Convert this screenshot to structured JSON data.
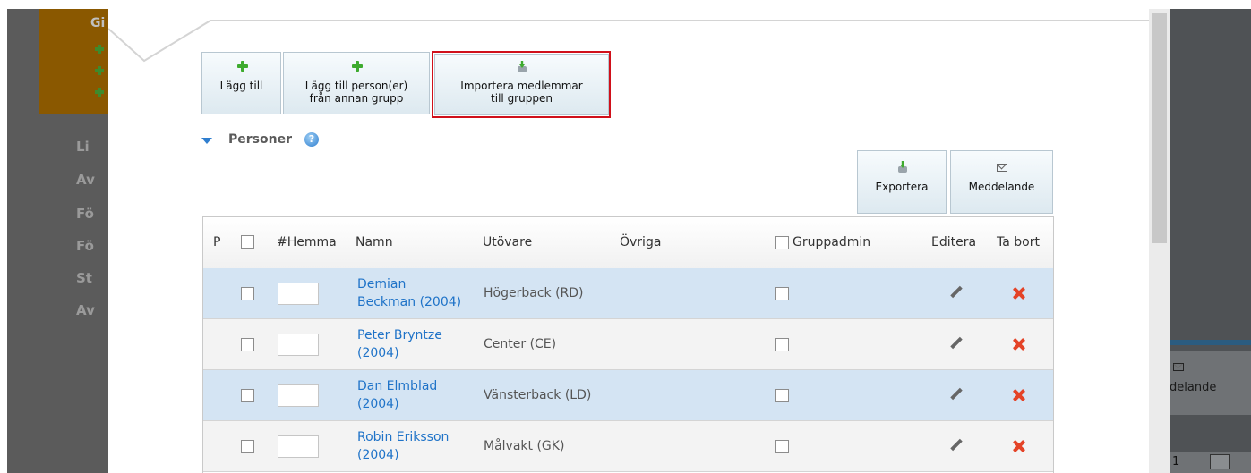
{
  "background": {
    "side_letters": [
      "Gi"
    ],
    "menu_letters": [
      "Li",
      "Av",
      "Fö",
      "Fö",
      "St",
      "Av"
    ],
    "right_button_label": "delande",
    "right_select_value": "1"
  },
  "toolbar": {
    "add_label": "Lägg till",
    "add_from_group_line1": "Lägg till person(er)",
    "add_from_group_line2": "från annan grupp",
    "import_line1": "Importera medlemmar",
    "import_line2": "till gruppen"
  },
  "section": {
    "title": "Personer",
    "help": "?"
  },
  "actions": {
    "export_label": "Exportera",
    "message_label": "Meddelande"
  },
  "table": {
    "headers": {
      "p": "P",
      "home_number": "#Hemma",
      "name": "Namn",
      "player": "Utövare",
      "other": "Övriga",
      "group_admin": "Gruppadmin",
      "edit": "Editera",
      "delete": "Ta bort"
    },
    "rows": [
      {
        "name_line1": "Demian",
        "name_line2": "Beckman (2004)",
        "position": "Högerback (RD)"
      },
      {
        "name_line1": "Peter Bryntze",
        "name_line2": "(2004)",
        "position": "Center (CE)"
      },
      {
        "name_line1": "Dan Elmblad",
        "name_line2": "(2004)",
        "position": "Vänsterback (LD)"
      },
      {
        "name_line1": "Robin Eriksson",
        "name_line2": "(2004)",
        "position": "Målvakt (GK)"
      }
    ]
  }
}
